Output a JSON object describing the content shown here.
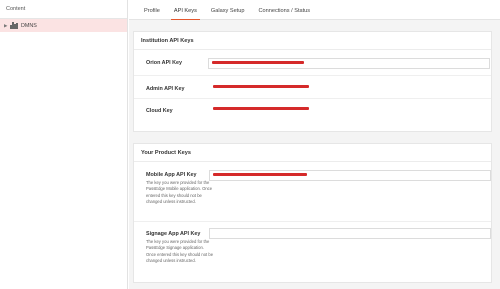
{
  "sidebar": {
    "header": "Content",
    "tree": [
      {
        "label": "DMNS",
        "icon": "building-icon"
      }
    ]
  },
  "tabs": [
    {
      "label": "Profile"
    },
    {
      "label": "API Keys",
      "active": true
    },
    {
      "label": "Galaxy Setup"
    },
    {
      "label": "Connections / Status"
    }
  ],
  "institution_keys": {
    "title": "Institution API Keys",
    "rows": [
      {
        "label": "Orion API Key"
      },
      {
        "label": "Admin API Key"
      },
      {
        "label": "Cloud Key"
      }
    ]
  },
  "product_keys": {
    "title": "Your Product Keys",
    "rows": [
      {
        "label": "Mobile App API Key",
        "help": "The key you were provided for the PassEdge Mobile application. Once entered this key should not be changed unless instructed."
      },
      {
        "label": "Signage App API Key",
        "help": "The key you were provided for the PassEdge Signage application. Once entered this key should not be changed unless instructed."
      }
    ]
  },
  "colors": {
    "accent": "#e4572e",
    "selected_row": "#fbe3e3",
    "redaction": "#d52a2a"
  }
}
